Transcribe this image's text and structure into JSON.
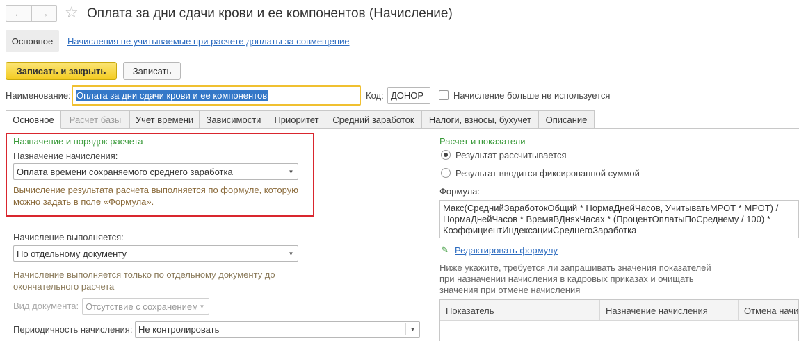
{
  "window": {
    "title": "Оплата за дни сдачи крови и ее компонентов (Начисление)",
    "back_icon": "←",
    "forward_icon": "→",
    "star_icon": "☆"
  },
  "sections": {
    "main": "Основное",
    "link": "Начисления не учитываемые при расчете доплаты за совмещение"
  },
  "toolbar": {
    "save_close": "Записать и закрыть",
    "save": "Записать"
  },
  "header": {
    "name_label": "Наименование:",
    "name_value": "Оплата за дни сдачи крови и ее компонентов",
    "code_label": "Код:",
    "code_value": "ДОНОР",
    "unused_label": "Начисление больше не используется"
  },
  "tabs": [
    {
      "label": "Основное"
    },
    {
      "label": "Расчет базы"
    },
    {
      "label": "Учет времени"
    },
    {
      "label": "Зависимости"
    },
    {
      "label": "Приоритет"
    },
    {
      "label": "Средний заработок"
    },
    {
      "label": "Налоги, взносы, бухучет"
    },
    {
      "label": "Описание"
    }
  ],
  "left": {
    "group_title": "Назначение и порядок расчета",
    "purpose_label": "Назначение начисления:",
    "purpose_value": "Оплата времени сохраняемого среднего заработка",
    "purpose_hint": "Вычисление результата расчета выполняется по формуле, которую можно задать в поле «Формула».",
    "performed_label": "Начисление выполняется:",
    "performed_value": "По отдельному документу",
    "performed_hint": "Начисление выполняется только по отдельному документу до окончательного расчета",
    "doc_type_label": "Вид документа:",
    "doc_type_value": "Отсутствие с сохранением",
    "periodicity_label": "Периодичность начисления:",
    "periodicity_value": "Не контролировать"
  },
  "right": {
    "group_title": "Расчет и показатели",
    "radio_calc": "Результат рассчитывается",
    "radio_fixed": "Результат вводится фиксированной суммой",
    "formula_label": "Формула:",
    "formula_text": "Макс(СреднийЗаработокОбщий * НормаДнейЧасов, УчитыватьМРОТ * МРОТ) / НормаДнейЧасов * ВремяВДняхЧасах * (ПроцентОплатыПоСреднему / 100) * КоэффициентИндексацииСреднегоЗаработка",
    "edit_formula": "Редактировать формулу",
    "indicators_hint": "Ниже укажите, требуется ли запрашивать значения показателей при назначении начисления в кадровых приказах и очищать значения при отмене начисления",
    "columns": [
      "Показатель",
      "Назначение начисления",
      "Отмена начисления"
    ]
  }
}
